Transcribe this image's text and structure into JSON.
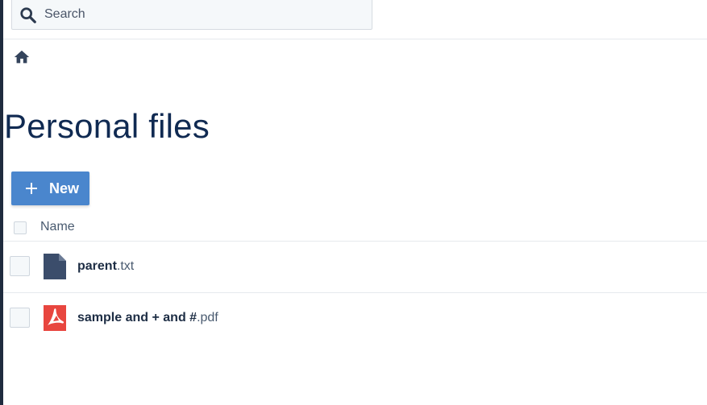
{
  "search": {
    "placeholder": "Search"
  },
  "breadcrumb": {
    "home_icon": "home-icon"
  },
  "page": {
    "title": "Personal files"
  },
  "toolbar": {
    "new_label": "New",
    "new_icon": "plus-icon",
    "new_color": "#4a86cd"
  },
  "table": {
    "columns": [
      "Name"
    ],
    "rows": [
      {
        "base": "parent",
        "ext": ".txt",
        "icon": "text-file-icon"
      },
      {
        "base": "sample and + and #",
        "ext": ".pdf",
        "icon": "pdf-file-icon"
      }
    ]
  },
  "colors": {
    "title": "#102a52",
    "text_file_icon": "#3b4d6b",
    "pdf_icon": "#e8463f"
  }
}
